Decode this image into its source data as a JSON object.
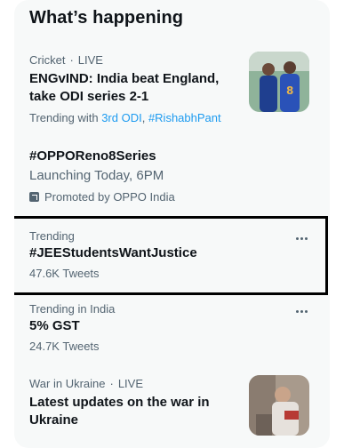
{
  "section_title": "What’s happening",
  "items": [
    {
      "category": "Cricket",
      "status": "LIVE",
      "headline": "ENGvIND: India beat England, take ODI series 2-1",
      "trending_with_label": "Trending with",
      "trending_with_links": [
        "3rd ODI",
        "#RishabhPant"
      ]
    },
    {
      "headline": "#OPPOReno8Series",
      "subtitle": "Launching Today, 6PM",
      "promoted_by": "Promoted by OPPO India"
    },
    {
      "context": "Trending",
      "headline": "#JEEStudentsWantJustice",
      "count": "47.6K Tweets"
    },
    {
      "context": "Trending in India",
      "headline": "5% GST",
      "count": "24.7K Tweets"
    },
    {
      "category": "War in Ukraine",
      "status": "LIVE",
      "headline": "Latest updates on the war in Ukraine"
    }
  ],
  "separator": "·",
  "colors": {
    "panel_bg": "#f7f9f9",
    "text_primary": "#0f1419",
    "text_secondary": "#536471",
    "link": "#1d9bf0",
    "highlight_border": "#000000"
  },
  "icons": [
    "more-options-icon",
    "promoted-icon"
  ]
}
